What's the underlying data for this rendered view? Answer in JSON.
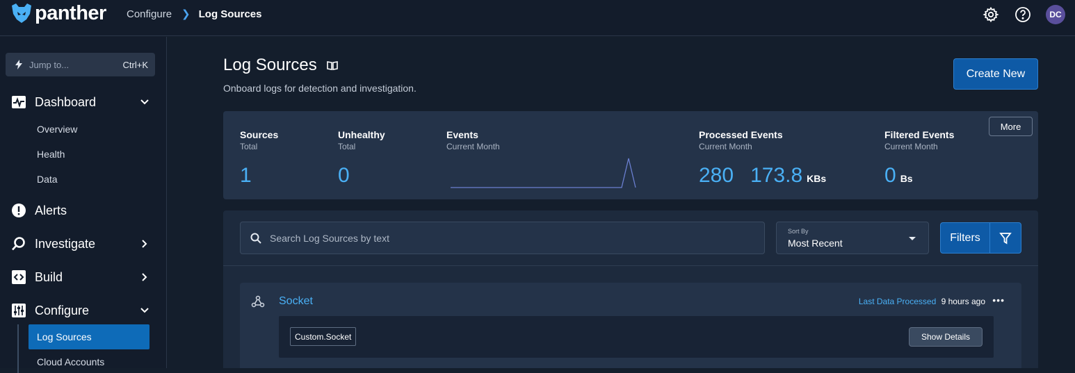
{
  "app": {
    "name": "panther"
  },
  "breadcrumb": {
    "parent": "Configure",
    "current": "Log Sources"
  },
  "header": {
    "avatar_initials": "DC"
  },
  "sidebar": {
    "jump": {
      "placeholder": "Jump to...",
      "shortcut": "Ctrl+K"
    },
    "dashboard": {
      "label": "Dashboard",
      "children": [
        "Overview",
        "Health",
        "Data"
      ]
    },
    "alerts": {
      "label": "Alerts"
    },
    "investigate": {
      "label": "Investigate"
    },
    "build": {
      "label": "Build"
    },
    "configure": {
      "label": "Configure",
      "children": [
        "Log Sources",
        "Cloud Accounts"
      ]
    }
  },
  "page": {
    "title": "Log Sources",
    "subtitle": "Onboard logs for detection and investigation.",
    "create_button": "Create New"
  },
  "stats": {
    "more_button": "More",
    "sources": {
      "label": "Sources",
      "caption": "Total",
      "value": "1"
    },
    "unhealthy": {
      "label": "Unhealthy",
      "caption": "Total",
      "value": "0"
    },
    "events": {
      "label": "Events",
      "caption": "Current Month"
    },
    "processed": {
      "label": "Processed Events",
      "caption": "Current Month",
      "count": "280",
      "size": "173.8",
      "unit": "KBs"
    },
    "filtered": {
      "label": "Filtered Events",
      "caption": "Current Month",
      "size": "0",
      "unit": "Bs"
    }
  },
  "list": {
    "search_placeholder": "Search Log Sources by text",
    "sort_label": "Sort By",
    "sort_value": "Most Recent",
    "filters_button": "Filters",
    "sources": [
      {
        "name": "Socket",
        "last_processed_label": "Last Data Processed",
        "last_processed_value": "9 hours ago",
        "tag": "Custom.Socket",
        "details_button": "Show Details"
      }
    ]
  },
  "colors": {
    "accent": "#4ab0f5",
    "primary_button": "#0e5aa6",
    "active_nav": "#0e6bb8"
  },
  "icons": [
    "panther-logo-icon",
    "gear-icon",
    "help-icon",
    "bolt-icon",
    "pulse-icon",
    "alert-icon",
    "search-icon",
    "code-icon",
    "sliders-icon",
    "book-icon",
    "filter-icon",
    "webhook-icon",
    "ellipsis-icon"
  ]
}
